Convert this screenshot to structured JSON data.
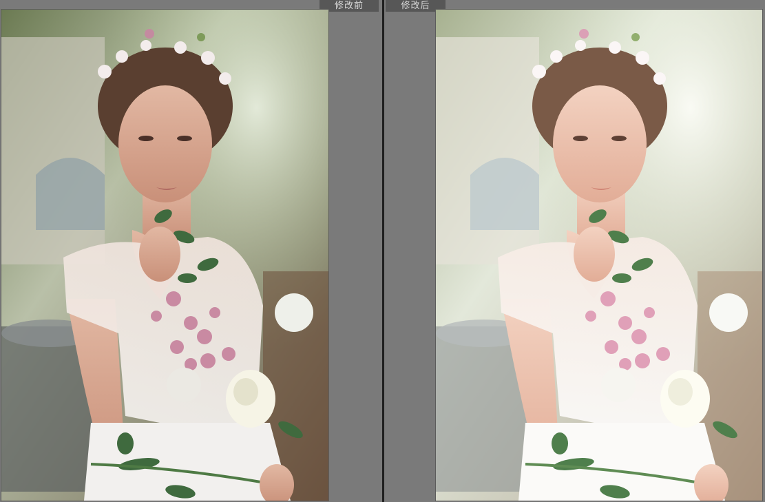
{
  "compare": {
    "before": {
      "label": "修改前"
    },
    "after": {
      "label": "修改后"
    }
  },
  "colors": {
    "background": "#7a7a7a",
    "tab": "#575757",
    "tab_text": "#d8d8d8",
    "divider": "#1e1e1e"
  }
}
